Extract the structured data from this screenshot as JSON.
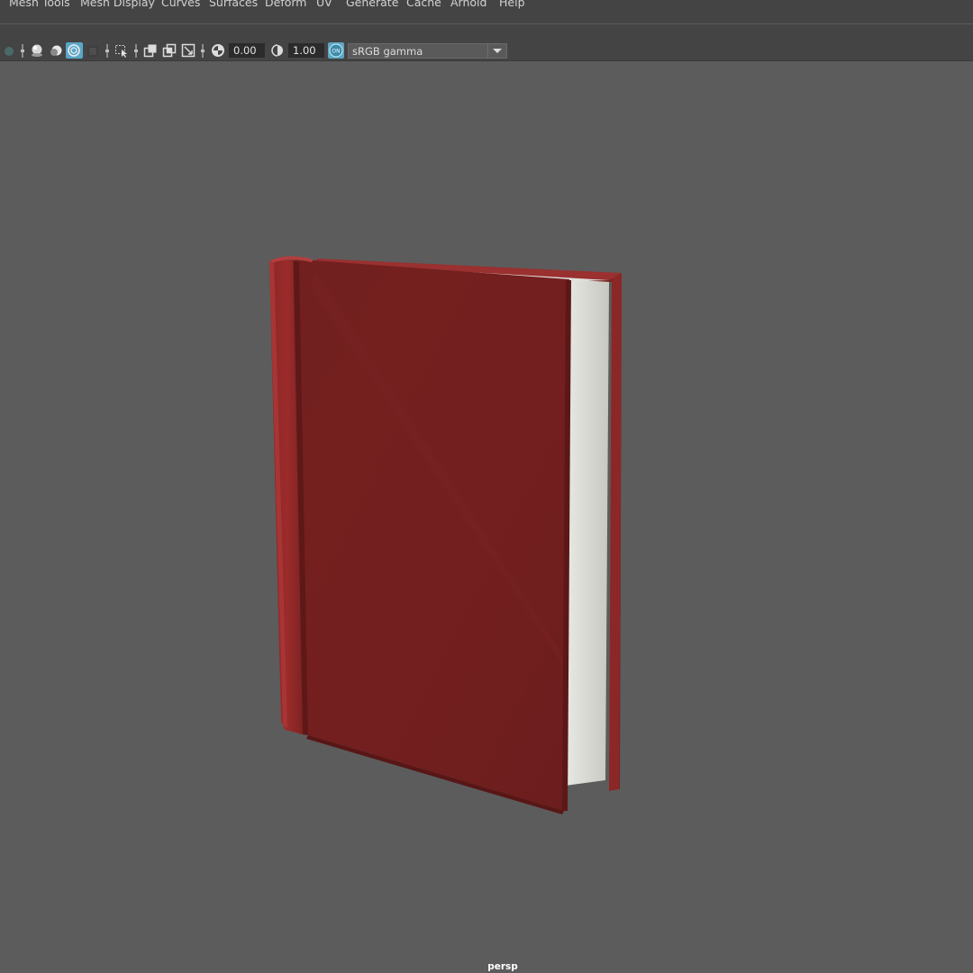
{
  "menubar": {
    "items": [
      "Mesh Tools",
      "Mesh Display",
      "Curves",
      "Surfaces",
      "Deform",
      "UV",
      "Generate",
      "Cache",
      "Arnold",
      "Help"
    ]
  },
  "toolbar": {
    "exposure_value": "0.00",
    "gamma_value": "1.00",
    "color_management_toggle": "ON",
    "color_space": "sRGB gamma",
    "icons": [
      "shading-sphere-icon",
      "lighting-sphere-icon",
      "isolate-select-icon",
      "xray-icon",
      "select-camera-icon",
      "film-gate-icon",
      "resolution-gate-icon",
      "safe-frame-icon",
      "exposure-icon",
      "gamma-icon",
      "color-management-icon"
    ],
    "accent_color": "#5ba7c7"
  },
  "viewport": {
    "camera_label": "persp",
    "background_color": "#5c5c5c",
    "object": {
      "name": "book",
      "cover_color": "#75201f",
      "pages_color": "#d0d2cb"
    }
  }
}
